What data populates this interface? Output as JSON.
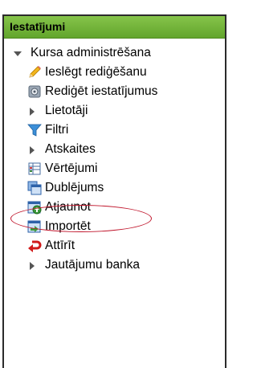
{
  "block": {
    "title": "Iestatījumi",
    "items": [
      {
        "label": "Kursa administrēšana",
        "icon": "expanded-triangle-icon"
      },
      {
        "label": "Ieslēgt rediģēšanu",
        "icon": "pencil-icon"
      },
      {
        "label": "Rediģēt iestatījumus",
        "icon": "settings-icon"
      },
      {
        "label": "Lietotāji",
        "icon": "collapsed-triangle-icon"
      },
      {
        "label": "Filtri",
        "icon": "filter-icon"
      },
      {
        "label": "Atskaites",
        "icon": "collapsed-triangle-icon"
      },
      {
        "label": "Vērtējumi",
        "icon": "grades-icon"
      },
      {
        "label": "Dublējums",
        "icon": "backup-icon"
      },
      {
        "label": "Atjaunot",
        "icon": "restore-icon"
      },
      {
        "label": "Importēt",
        "icon": "import-icon"
      },
      {
        "label": "Attīrīt",
        "icon": "reset-icon"
      },
      {
        "label": "Jautājumu banka",
        "icon": "collapsed-triangle-icon"
      }
    ]
  },
  "annotation": {
    "color": "#c0162c",
    "target": "Vērtējumi"
  }
}
